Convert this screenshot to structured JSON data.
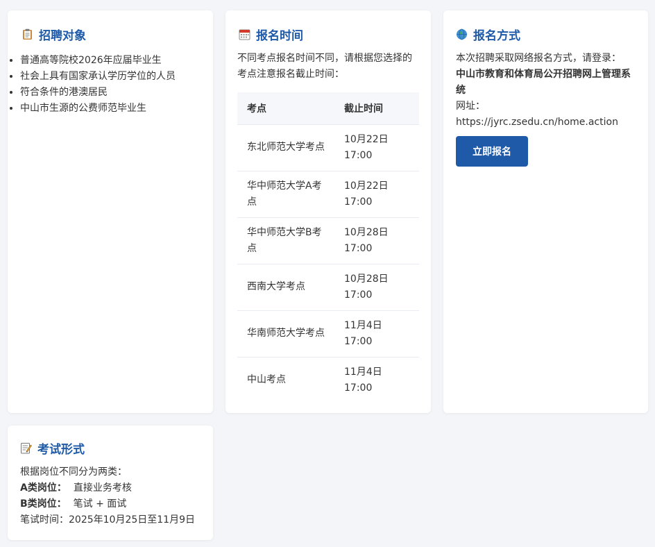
{
  "targets_card": {
    "title": "招聘对象",
    "icon": "clipboard-icon",
    "items": [
      "普通高等院校2026年应届毕业生",
      "社会上具有国家承认学历学位的人员",
      "符合条件的港澳居民",
      "中山市生源的公费师范毕业生"
    ]
  },
  "schedule_card": {
    "title": "报名时间",
    "icon": "calendar-icon",
    "intro": "不同考点报名时间不同，请根据您选择的考点注意报名截止时间：",
    "headers": [
      "考点",
      "截止时间"
    ],
    "rows": [
      {
        "site": "东北师范大学考点",
        "deadline": "10月22日17:00"
      },
      {
        "site": "华中师范大学A考点",
        "deadline": "10月22日17:00"
      },
      {
        "site": "华中师范大学B考点",
        "deadline": "10月28日17:00"
      },
      {
        "site": "西南大学考点",
        "deadline": "10月28日17:00"
      },
      {
        "site": "华南师范大学考点",
        "deadline": "11月4日17:00"
      },
      {
        "site": "中山考点",
        "deadline": "11月4日17:00"
      }
    ]
  },
  "method_card": {
    "title": "报名方式",
    "icon": "globe-icon",
    "intro": "本次招聘采取网络报名方式，请登录：",
    "system_name": "中山市教育和体育局公开招聘网上管理系统",
    "url_label": "网址：",
    "url": "https://jyrc.zsedu.cn/home.action",
    "button_label": "立即报名"
  },
  "exam_card": {
    "title": "考试形式",
    "icon": "memo-icon",
    "intro": "根据岗位不同分为两类：",
    "a_label": "A类岗位：",
    "a_value": "直接业务考核",
    "b_label": "B类岗位：",
    "b_value": "笔试 + 面试",
    "time_label": "笔试时间：",
    "time_value": "2025年10月25日至11月9日"
  },
  "colors": {
    "accent": "#1e5aa8",
    "background": "#f3f5f9",
    "card": "#ffffff"
  }
}
